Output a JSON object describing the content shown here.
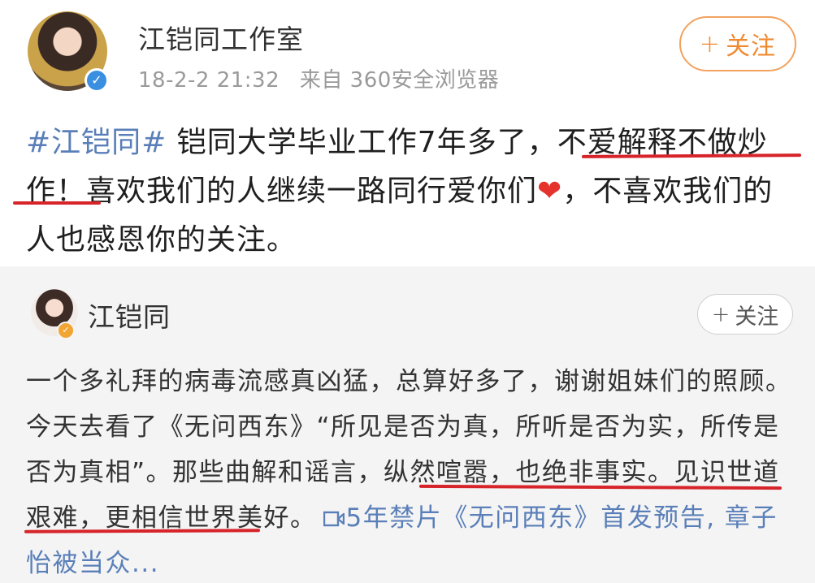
{
  "post": {
    "author": "江铠同工作室",
    "date": "18-2-2 21:32",
    "source": "来自 360安全浏览器",
    "follow_plus": "+",
    "follow_label": "关注",
    "hashtag": "#江铠同#",
    "text_part1": " 铠同大学毕业工作7年多了，不爱解释不做炒作！喜欢我们的人继续一路同行爱你们",
    "heart_icon": "❤",
    "text_part2": "，不喜欢我们的人也感恩你的关注。"
  },
  "repost": {
    "author": "江铠同",
    "follow_plus": "+",
    "follow_label": "关注",
    "text": "一个多礼拜的病毒流感真凶猛，总算好多了，谢谢姐妹们的照顾。今天去看了《无问西东》“所见是否为真，所听是否为实，所传是否为真相”。那些曲解和谣言，纵然喧嚣，也绝非事实。见识世道艰难，更相信世界美好。",
    "link_text": "5年禁片《无问西东》首发预告, 章子怡被当众..."
  },
  "colors": {
    "accent_orange": "#f08a30",
    "link_blue": "#5a7fb8",
    "underline_red": "#d6242a",
    "verified_blue": "#3b8fe0",
    "verified_gold": "#f3a533"
  },
  "icons": [
    "verified-badge-icon",
    "heart-icon",
    "video-link-icon"
  ]
}
